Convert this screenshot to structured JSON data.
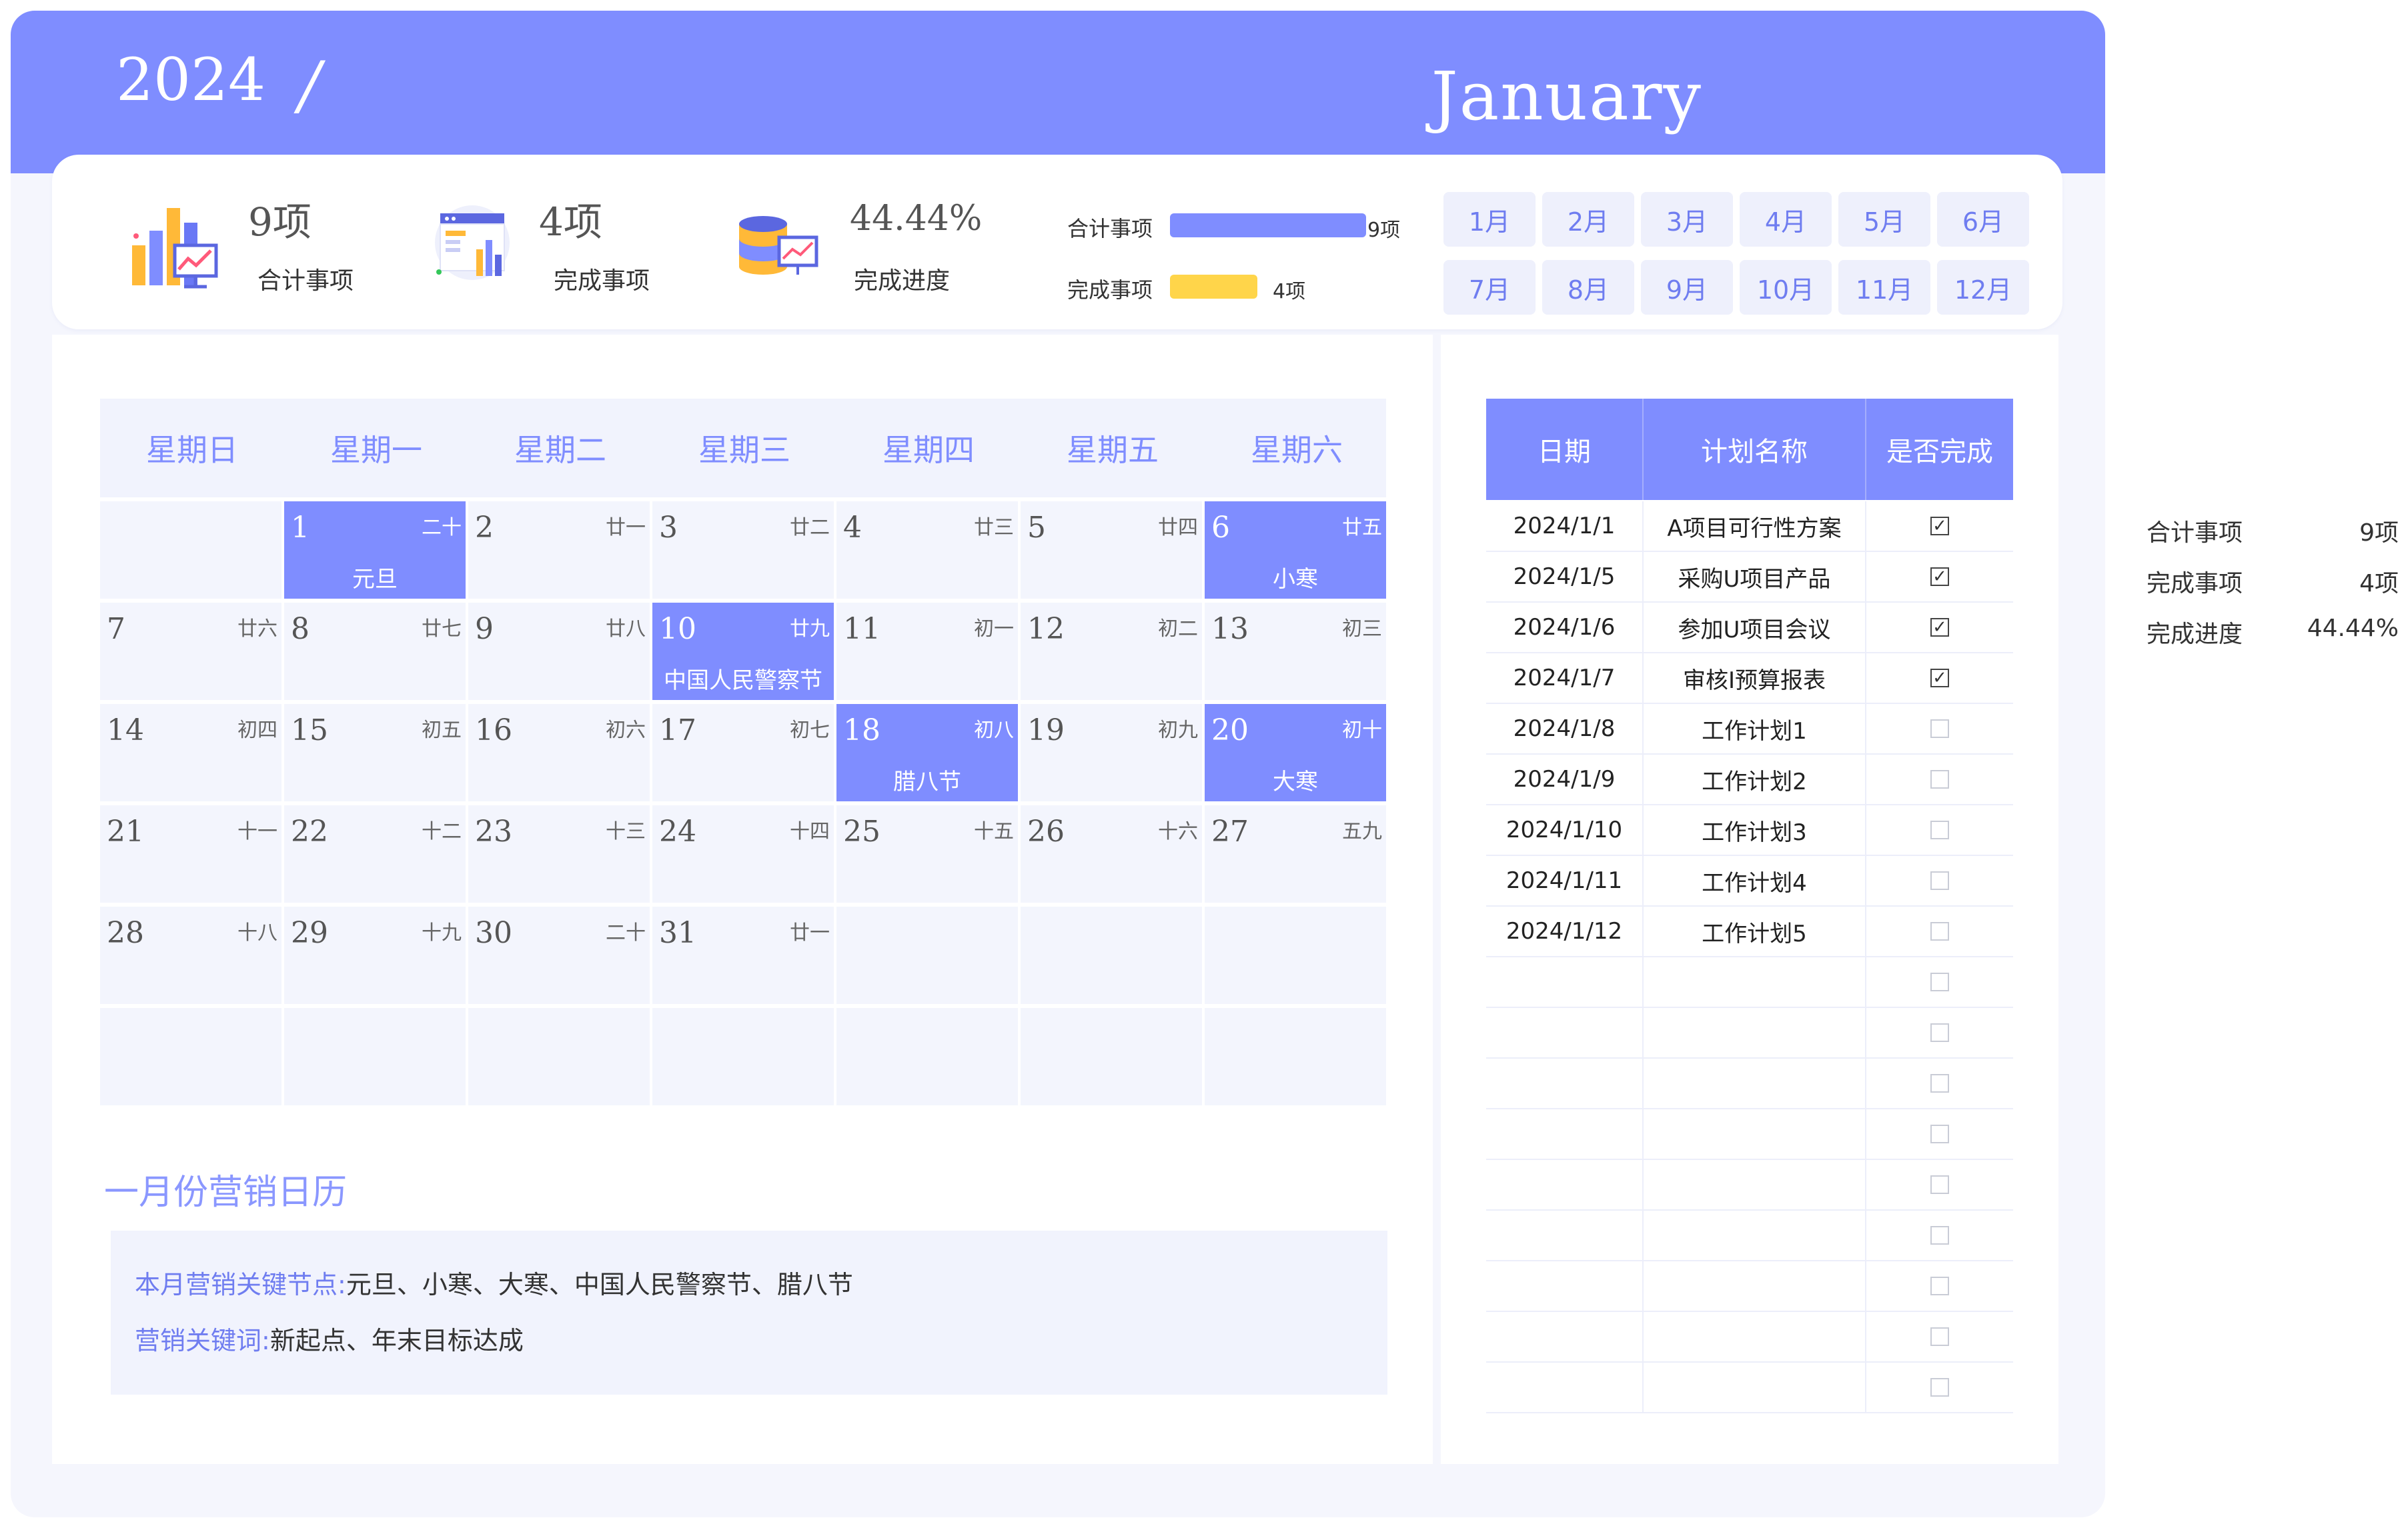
{
  "header": {
    "year": "2024",
    "separator": "/",
    "month_name": "January"
  },
  "summary": {
    "stats": [
      {
        "value": "9项",
        "label": "合计事项",
        "icon": "bar-chart-presentation-icon"
      },
      {
        "value": "4项",
        "label": "完成事项",
        "icon": "dashboard-report-icon"
      },
      {
        "value": "44.44%",
        "label": "完成进度",
        "icon": "database-chart-icon"
      }
    ],
    "bars": [
      {
        "label": "合计事项",
        "value_text": "9项",
        "fraction": 1.0,
        "color": "#7f8dff"
      },
      {
        "label": "完成事项",
        "value_text": "4项",
        "fraction": 0.444,
        "color": "#ffd54a"
      }
    ],
    "months": [
      "1月",
      "2月",
      "3月",
      "4月",
      "5月",
      "6月",
      "7月",
      "8月",
      "9月",
      "10月",
      "11月",
      "12月"
    ]
  },
  "calendar": {
    "weekdays": [
      "星期日",
      "星期一",
      "星期二",
      "星期三",
      "星期四",
      "星期五",
      "星期六"
    ],
    "weeks": [
      [
        null,
        {
          "day": "1",
          "lunar": "二十",
          "fest": "元旦",
          "hl": true
        },
        {
          "day": "2",
          "lunar": "廿一"
        },
        {
          "day": "3",
          "lunar": "廿二"
        },
        {
          "day": "4",
          "lunar": "廿三"
        },
        {
          "day": "5",
          "lunar": "廿四"
        },
        {
          "day": "6",
          "lunar": "廿五",
          "fest": "小寒",
          "hl": true
        }
      ],
      [
        {
          "day": "7",
          "lunar": "廿六"
        },
        {
          "day": "8",
          "lunar": "廿七"
        },
        {
          "day": "9",
          "lunar": "廿八"
        },
        {
          "day": "10",
          "lunar": "廿九",
          "fest": "中国人民警察节",
          "hl": true
        },
        {
          "day": "11",
          "lunar": "初一"
        },
        {
          "day": "12",
          "lunar": "初二"
        },
        {
          "day": "13",
          "lunar": "初三"
        }
      ],
      [
        {
          "day": "14",
          "lunar": "初四"
        },
        {
          "day": "15",
          "lunar": "初五"
        },
        {
          "day": "16",
          "lunar": "初六"
        },
        {
          "day": "17",
          "lunar": "初七"
        },
        {
          "day": "18",
          "lunar": "初八",
          "fest": "腊八节",
          "hl": true
        },
        {
          "day": "19",
          "lunar": "初九"
        },
        {
          "day": "20",
          "lunar": "初十",
          "fest": "大寒",
          "hl": true
        }
      ],
      [
        {
          "day": "21",
          "lunar": "十一"
        },
        {
          "day": "22",
          "lunar": "十二"
        },
        {
          "day": "23",
          "lunar": "十三"
        },
        {
          "day": "24",
          "lunar": "十四"
        },
        {
          "day": "25",
          "lunar": "十五"
        },
        {
          "day": "26",
          "lunar": "十六"
        },
        {
          "day": "27",
          "lunar": "五九"
        }
      ],
      [
        {
          "day": "28",
          "lunar": "十八"
        },
        {
          "day": "29",
          "lunar": "十九"
        },
        {
          "day": "30",
          "lunar": "二十"
        },
        {
          "day": "31",
          "lunar": "廿一"
        },
        null,
        null,
        null
      ],
      [
        null,
        null,
        null,
        null,
        null,
        null,
        null
      ]
    ],
    "title": "一月份营销日历",
    "key_nodes_label": "本月营销关键节点:",
    "key_nodes_value": "元旦、小寒、大寒、中国人民警察节、腊八节",
    "keywords_label": "营销关键词:",
    "keywords_value": "新起点、年末目标达成"
  },
  "table": {
    "headers": [
      "日期",
      "计划名称",
      "是否完成"
    ],
    "rows": [
      {
        "date": "2024/1/1",
        "name": "A项目可行性方案",
        "done": true
      },
      {
        "date": "2024/1/5",
        "name": "采购U项目产品",
        "done": true
      },
      {
        "date": "2024/1/6",
        "name": "参加U项目会议",
        "done": true
      },
      {
        "date": "2024/1/7",
        "name": "审核I预算报表",
        "done": true
      },
      {
        "date": "2024/1/8",
        "name": "工作计划1",
        "done": false
      },
      {
        "date": "2024/1/9",
        "name": "工作计划2",
        "done": false
      },
      {
        "date": "2024/1/10",
        "name": "工作计划3",
        "done": false
      },
      {
        "date": "2024/1/11",
        "name": "工作计划4",
        "done": false
      },
      {
        "date": "2024/1/12",
        "name": "工作计划5",
        "done": false
      },
      {
        "date": "",
        "name": "",
        "done": false
      },
      {
        "date": "",
        "name": "",
        "done": false
      },
      {
        "date": "",
        "name": "",
        "done": false
      },
      {
        "date": "",
        "name": "",
        "done": false
      },
      {
        "date": "",
        "name": "",
        "done": false
      },
      {
        "date": "",
        "name": "",
        "done": false
      },
      {
        "date": "",
        "name": "",
        "done": false
      },
      {
        "date": "",
        "name": "",
        "done": false
      },
      {
        "date": "",
        "name": "",
        "done": false
      }
    ],
    "check_mark": "✓"
  },
  "side_stats": [
    {
      "label": "合计事项",
      "value": "9项"
    },
    {
      "label": "完成事项",
      "value": "4项"
    },
    {
      "label": "完成进度",
      "value": "44.44%"
    }
  ],
  "colors": {
    "accent": "#7f8dff",
    "accent_light": "#f1f3fd",
    "highlight_yellow": "#ffd54a"
  }
}
